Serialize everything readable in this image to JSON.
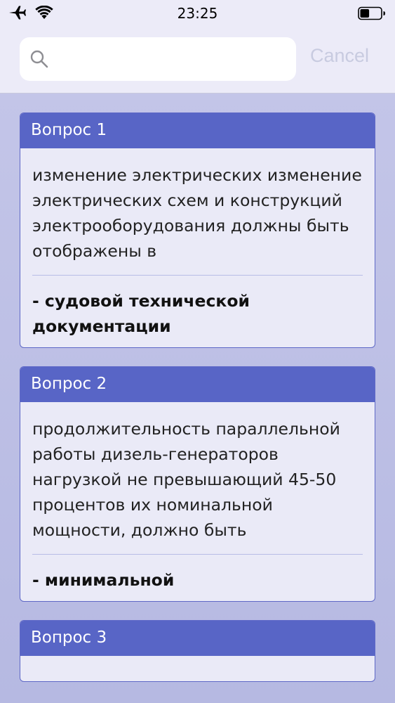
{
  "status_bar": {
    "time": "23:25",
    "icons": [
      "airplane-icon",
      "wifi-icon",
      "battery-icon"
    ],
    "battery_level": 0.45
  },
  "search": {
    "value": "",
    "placeholder": "",
    "cancel_label": "Cancel"
  },
  "colors": {
    "accent": "#5865c6",
    "card_background": "#eaeaf7",
    "list_background": "#bcbfe5",
    "cancel_text": "#c8cbe0"
  },
  "cards": [
    {
      "header": "Вопрос 1",
      "question": "изменение электрических изменение электрических схем и конструкций электрооборудования должны быть отображены в",
      "answer": "- судовой технической документации"
    },
    {
      "header": "Вопрос 2",
      "question": "продолжительность параллельной работы дизель-генераторов нагрузкой не превышающий 45-50 процентов их номинальной мощности, должно быть",
      "answer": "-  минимальной"
    },
    {
      "header": "Вопрос 3",
      "question": "",
      "answer": ""
    }
  ]
}
